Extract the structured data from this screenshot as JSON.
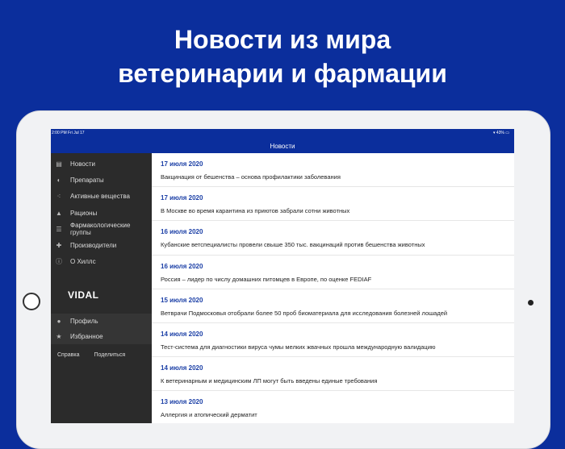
{
  "headline": {
    "line1": "Новости из мира",
    "line2": "ветеринарии и фармации"
  },
  "status": {
    "time": "2:00 PM  Fri Jul 17",
    "battery": "43%"
  },
  "nav_title": "Новости",
  "menu": [
    {
      "label": "Новости",
      "icon": "newspaper-icon"
    },
    {
      "label": "Препараты",
      "icon": "pill-icon"
    },
    {
      "label": "Активные вещества",
      "icon": "molecule-icon"
    },
    {
      "label": "Рационы",
      "icon": "food-bowl-icon"
    },
    {
      "label": "Фармакологические группы",
      "icon": "list-icon"
    },
    {
      "label": "Производители",
      "icon": "plus-icon"
    },
    {
      "label": "О Хиллс",
      "icon": "info-icon"
    }
  ],
  "logo": "VIDAL",
  "account": [
    {
      "label": "Профиль",
      "icon": "user-icon"
    },
    {
      "label": "Избранное",
      "icon": "star-icon"
    }
  ],
  "links": {
    "help": "Справка",
    "share": "Поделиться"
  },
  "news": [
    {
      "date": "17 июля 2020",
      "title": "Вакцинация от бешенства – основа профилактики заболевания"
    },
    {
      "date": "17 июля 2020",
      "title": "В Москве во время карантина из приютов забрали сотни животных"
    },
    {
      "date": "16 июля 2020",
      "title": "Кубанские ветспециалисты провели свыше 350 тыс. вакцинаций против бешенства животных"
    },
    {
      "date": "16 июля 2020",
      "title": "Россия – лидер по числу домашних питомцев в Европе, по оценке FEDIAF"
    },
    {
      "date": "15 июля 2020",
      "title": "Ветврачи Подмосковья отобрали более 50 проб биоматериала для исследования болезней лошадей"
    },
    {
      "date": "14 июля 2020",
      "title": "Тест-система для диагностики вируса чумы мелких жвачных прошла международную валидацию"
    },
    {
      "date": "14 июля 2020",
      "title": "К ветеринарным и медицинским ЛП могут быть введены единые требования"
    },
    {
      "date": "13 июля 2020",
      "title": "Аллергия и атопический дерматит"
    }
  ]
}
